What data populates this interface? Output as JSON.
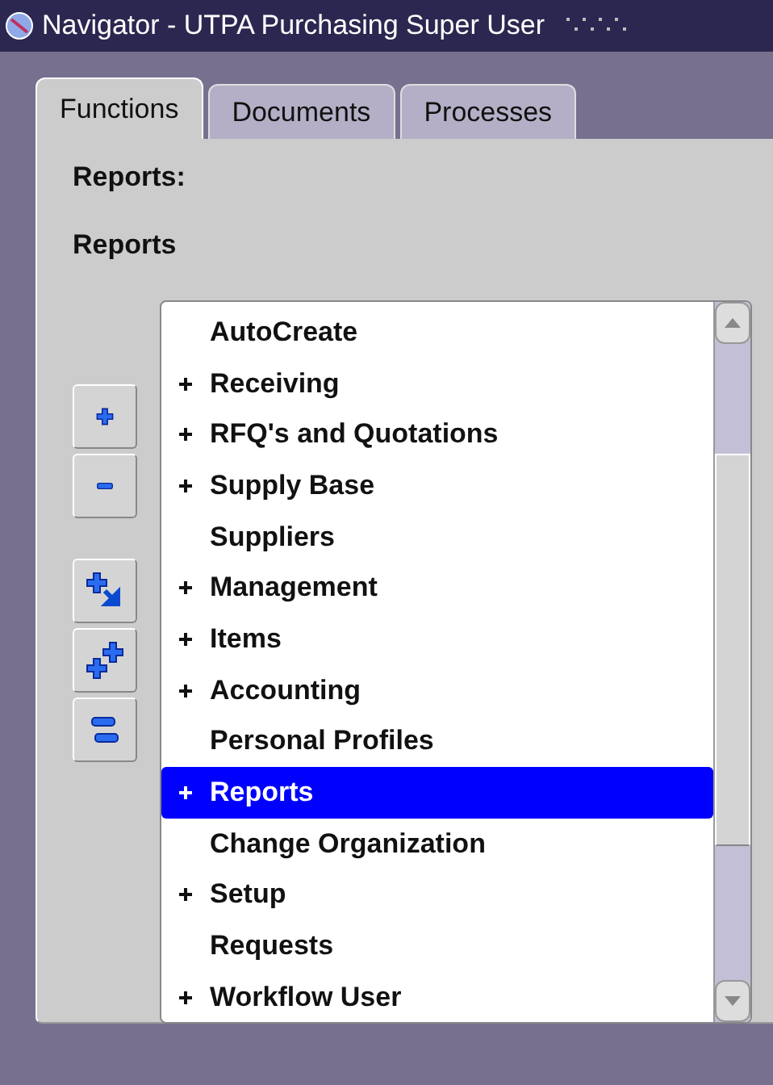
{
  "window": {
    "title": "Navigator - UTPA Purchasing Super User"
  },
  "tabs": [
    {
      "label": "Functions",
      "selected": true
    },
    {
      "label": "Documents",
      "selected": false
    },
    {
      "label": "Processes",
      "selected": false
    }
  ],
  "path_label": "Reports:",
  "current_label": "Reports",
  "tree": {
    "items": [
      {
        "label": "AutoCreate",
        "has_children": false,
        "selected": false
      },
      {
        "label": "Receiving",
        "has_children": true,
        "selected": false
      },
      {
        "label": "RFQ's and Quotations",
        "has_children": true,
        "selected": false
      },
      {
        "label": "Supply Base",
        "has_children": true,
        "selected": false
      },
      {
        "label": "Suppliers",
        "has_children": false,
        "selected": false
      },
      {
        "label": "Management",
        "has_children": true,
        "selected": false
      },
      {
        "label": "Items",
        "has_children": true,
        "selected": false
      },
      {
        "label": "Accounting",
        "has_children": true,
        "selected": false
      },
      {
        "label": "Personal Profiles",
        "has_children": false,
        "selected": false
      },
      {
        "label": "Reports",
        "has_children": true,
        "selected": true
      },
      {
        "label": "Change Organization",
        "has_children": false,
        "selected": false
      },
      {
        "label": "Setup",
        "has_children": true,
        "selected": false
      },
      {
        "label": "Requests",
        "has_children": false,
        "selected": false
      },
      {
        "label": "Workflow User",
        "has_children": true,
        "selected": false
      }
    ]
  },
  "tree_buttons": [
    {
      "kind": "expand"
    },
    {
      "kind": "collapse"
    },
    {
      "kind": "expand-branch"
    },
    {
      "kind": "expand-all"
    },
    {
      "kind": "collapse-all"
    }
  ]
}
